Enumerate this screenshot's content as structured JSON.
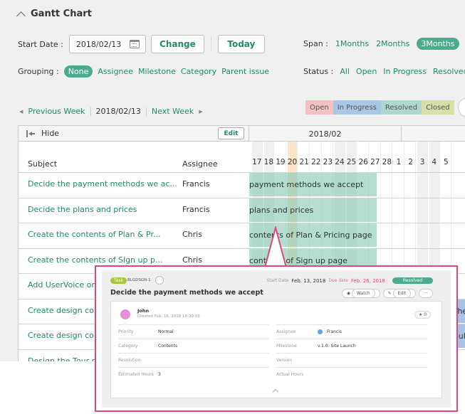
{
  "header": {
    "title": "Gantt Chart"
  },
  "controls": {
    "start_date_label": "Start Date :",
    "start_date_value": "2018/02/13",
    "change_label": "Change",
    "today_label": "Today",
    "span_label": "Span :",
    "span_options": [
      "1Months",
      "2Months",
      "3Months"
    ],
    "span_selected": "3Months",
    "grouping_label": "Grouping :",
    "grouping_options": [
      "None",
      "Assignee",
      "Milestone",
      "Category",
      "Parent issue"
    ],
    "grouping_selected": "None",
    "status_label": "Status :",
    "status_options": [
      "All",
      "Open",
      "In Progress",
      "Resolved"
    ]
  },
  "week_nav": {
    "prev": "Previous Week",
    "current": "2018/02/13",
    "next": "Next Week"
  },
  "legend": {
    "open": "Open",
    "in_progress": "In Progress",
    "resolved": "Resolved",
    "closed": "Closed"
  },
  "grid": {
    "hide_label": "Hide",
    "edit_label": "Edit",
    "month": "2018/02",
    "subject_header": "Subject",
    "assignee_header": "Assignee",
    "days": [
      "17",
      "18",
      "19",
      "20",
      "21",
      "22",
      "23",
      "24",
      "25",
      "26",
      "27",
      "28",
      "1",
      "2",
      "3",
      "4",
      "5"
    ],
    "today_day": "20",
    "rows": [
      {
        "subject": "Decide the payment methods we ac...",
        "assignee": "Francis",
        "bar": "payment methods we accept"
      },
      {
        "subject": "Decide the plans and prices",
        "assignee": "Francis",
        "bar": "plans and prices"
      },
      {
        "subject": "Create the contents of Plan & Pr...",
        "assignee": "Chris",
        "bar": "contents of Plan & Pricing page"
      },
      {
        "subject": "Create the contents of Sign up p...",
        "assignee": "Chris",
        "bar": "contents of Sign up page"
      },
      {
        "subject": "Add UserVoice on t",
        "assignee": "",
        "bar": ""
      },
      {
        "subject": "Create design comp",
        "assignee": "",
        "bar": "the"
      },
      {
        "subject": "Create design comp",
        "assignee": "",
        "bar": "sul"
      },
      {
        "subject": "Design the Tour pa",
        "assignee": "",
        "bar": ""
      }
    ]
  },
  "popup": {
    "type": "Task",
    "key": "BLGDSGN-1",
    "title": "Decide the payment methods we accept",
    "start_date_label": "Start Date",
    "start_date": "Feb. 13, 2018",
    "due_date_label": "Due date",
    "due_date": "Feb. 26, 2018",
    "status": "Resolved",
    "watch_label": "Watch",
    "edit_label": "Edit",
    "more_label": "···",
    "user": "John",
    "created": "Created Feb. 16, 2018 18:30:03",
    "stars": "0",
    "fields_left": [
      {
        "label": "Priority",
        "value": "Normal"
      },
      {
        "label": "Category",
        "value": "Contents"
      },
      {
        "label": "Resolution",
        "value": ""
      },
      {
        "label": "Estimated Hours",
        "value": "3"
      }
    ],
    "fields_right": [
      {
        "label": "Assignee",
        "value": "Francis"
      },
      {
        "label": "Milestone",
        "value": "v.1.0: Site Launch"
      },
      {
        "label": "Version",
        "value": ""
      },
      {
        "label": "Actual Hours",
        "value": ""
      }
    ]
  }
}
